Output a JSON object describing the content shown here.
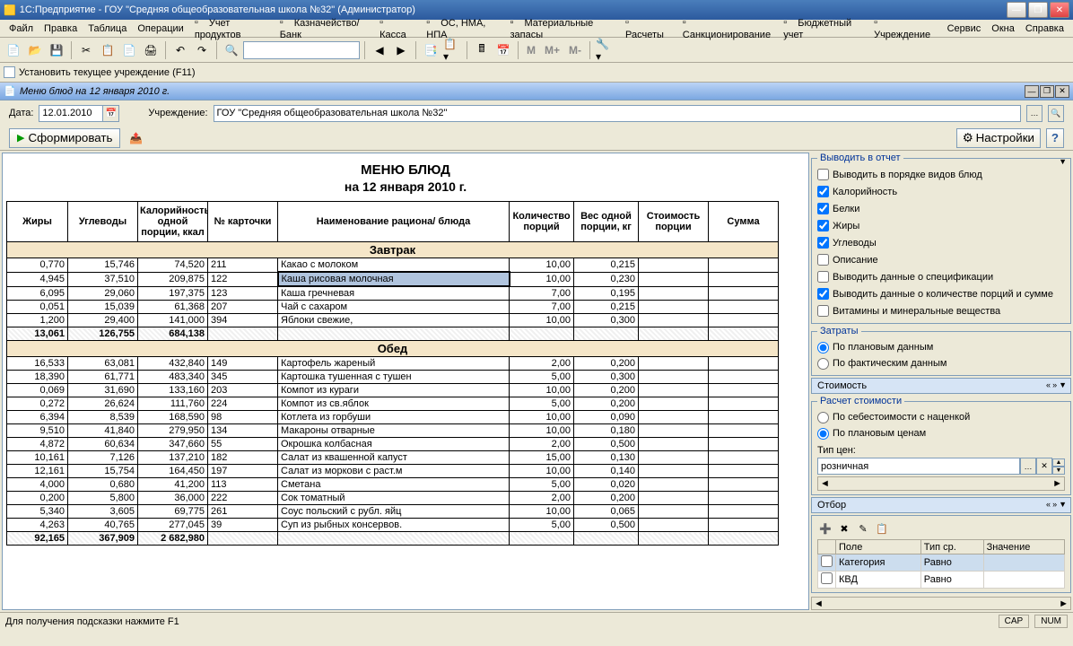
{
  "titlebar": "1С:Предприятие - ГОУ \"Средняя общеобразовательная школа №32\" (Администратор)",
  "menubar": [
    "Файл",
    "Правка",
    "Таблица",
    "Операции",
    "Учет продуктов",
    "Казначейство/Банк",
    "Касса",
    "ОС, НМА, НПА",
    "Материальные запасы",
    "Расчеты",
    "Санкционирование",
    "Бюджетный учет",
    "Учреждение",
    "Сервис",
    "Окна",
    "Справка"
  ],
  "secondbar": {
    "text": "Установить текущее учреждение (F11)"
  },
  "doc_title": "Меню блюд на 12 января 2010 г.",
  "params": {
    "date_label": "Дата:",
    "date": "12.01.2010",
    "inst_label": "Учреждение:",
    "inst": "ГОУ \"Средняя общеобразовательная школа №32\""
  },
  "actions": {
    "form": "Сформировать",
    "settings": "Настройки"
  },
  "report": {
    "title": "МЕНЮ БЛЮД",
    "subtitle": "на 12 января 2010 г.",
    "headers": [
      "Жиры",
      "Углеводы",
      "Калорийность одной порции, ккал",
      "№ карточки",
      "Наименование рациона/ блюда",
      "Количество порций",
      "Вес одной порции, кг",
      "Стоимость порции",
      "Сумма"
    ],
    "meals": [
      {
        "name": "Завтрак",
        "rows": [
          {
            "f": "0,770",
            "c": "15,746",
            "k": "74,520",
            "n": "211",
            "name": "Какао с молоком",
            "q": "10,00",
            "w": "0,215",
            "p": "",
            "s": ""
          },
          {
            "f": "4,945",
            "c": "37,510",
            "k": "209,875",
            "n": "122",
            "name": "Каша рисовая молочная",
            "q": "10,00",
            "w": "0,230",
            "p": "",
            "s": "",
            "sel": true
          },
          {
            "f": "6,095",
            "c": "29,060",
            "k": "197,375",
            "n": "123",
            "name": "Каша гречневая",
            "q": "7,00",
            "w": "0,195",
            "p": "",
            "s": ""
          },
          {
            "f": "0,051",
            "c": "15,039",
            "k": "61,368",
            "n": "207",
            "name": "Чай с сахаром",
            "q": "7,00",
            "w": "0,215",
            "p": "",
            "s": ""
          },
          {
            "f": "1,200",
            "c": "29,400",
            "k": "141,000",
            "n": "394",
            "name": "Яблоки свежие,",
            "q": "10,00",
            "w": "0,300",
            "p": "",
            "s": ""
          }
        ],
        "total": {
          "f": "13,061",
          "c": "126,755",
          "k": "684,138"
        }
      },
      {
        "name": "Обед",
        "rows": [
          {
            "f": "16,533",
            "c": "63,081",
            "k": "432,840",
            "n": "149",
            "name": "Картофель жареный",
            "q": "2,00",
            "w": "0,200",
            "p": "",
            "s": ""
          },
          {
            "f": "18,390",
            "c": "61,771",
            "k": "483,340",
            "n": "345",
            "name": "Картошка тушенная с тушен",
            "q": "5,00",
            "w": "0,300",
            "p": "",
            "s": ""
          },
          {
            "f": "0,069",
            "c": "31,690",
            "k": "133,160",
            "n": "203",
            "name": "Компот из кураги",
            "q": "10,00",
            "w": "0,200",
            "p": "",
            "s": ""
          },
          {
            "f": "0,272",
            "c": "26,624",
            "k": "111,760",
            "n": "224",
            "name": "Компот из св.яблок",
            "q": "5,00",
            "w": "0,200",
            "p": "",
            "s": ""
          },
          {
            "f": "6,394",
            "c": "8,539",
            "k": "168,590",
            "n": "98",
            "name": "Котлета из горбуши",
            "q": "10,00",
            "w": "0,090",
            "p": "",
            "s": ""
          },
          {
            "f": "9,510",
            "c": "41,840",
            "k": "279,950",
            "n": "134",
            "name": "Макароны отварные",
            "q": "10,00",
            "w": "0,180",
            "p": "",
            "s": ""
          },
          {
            "f": "4,872",
            "c": "60,634",
            "k": "347,660",
            "n": "55",
            "name": "Окрошка колбасная",
            "q": "2,00",
            "w": "0,500",
            "p": "",
            "s": ""
          },
          {
            "f": "10,161",
            "c": "7,126",
            "k": "137,210",
            "n": "182",
            "name": "Салат из квашенной капуст",
            "q": "15,00",
            "w": "0,130",
            "p": "",
            "s": ""
          },
          {
            "f": "12,161",
            "c": "15,754",
            "k": "164,450",
            "n": "197",
            "name": "Салат из моркови с раст.м",
            "q": "10,00",
            "w": "0,140",
            "p": "",
            "s": ""
          },
          {
            "f": "4,000",
            "c": "0,680",
            "k": "41,200",
            "n": "113",
            "name": "Сметана",
            "q": "5,00",
            "w": "0,020",
            "p": "",
            "s": ""
          },
          {
            "f": "0,200",
            "c": "5,800",
            "k": "36,000",
            "n": "222",
            "name": "Сок томатный",
            "q": "2,00",
            "w": "0,200",
            "p": "",
            "s": ""
          },
          {
            "f": "5,340",
            "c": "3,605",
            "k": "69,775",
            "n": "261",
            "name": "Соус польский с рубл. яйц",
            "q": "10,00",
            "w": "0,065",
            "p": "",
            "s": ""
          },
          {
            "f": "4,263",
            "c": "40,765",
            "k": "277,045",
            "n": "39",
            "name": "Суп из рыбных консервов.",
            "q": "5,00",
            "w": "0,500",
            "p": "",
            "s": ""
          }
        ],
        "total": {
          "f": "92,165",
          "c": "367,909",
          "k": "2 682,980"
        }
      }
    ]
  },
  "side": {
    "output": {
      "title": "Выводить в отчет",
      "opts": [
        {
          "label": "Выводить в порядке видов блюд",
          "chk": false
        },
        {
          "label": "Калорийность",
          "chk": true
        },
        {
          "label": "Белки",
          "chk": true
        },
        {
          "label": "Жиры",
          "chk": true
        },
        {
          "label": "Углеводы",
          "chk": true
        },
        {
          "label": "Описание",
          "chk": false
        },
        {
          "label": "Выводить данные о спецификации",
          "chk": false
        },
        {
          "label": "Выводить данные о количестве порций и сумме",
          "chk": true
        },
        {
          "label": "Витамины и минеральные вещества",
          "chk": false
        }
      ]
    },
    "zatraty": {
      "title": "Затраты",
      "opts": [
        {
          "label": "По плановым данным",
          "sel": true
        },
        {
          "label": "По фактическим данным",
          "sel": false
        }
      ]
    },
    "stoimost": {
      "title": "Стоимость",
      "raschet": "Расчет стоимости",
      "opts": [
        {
          "label": "По себестоимости с наценкой",
          "sel": false
        },
        {
          "label": "По плановым ценам",
          "sel": true
        }
      ],
      "price_label": "Тип цен:",
      "price": "розничная"
    },
    "otbor": {
      "title": "Отбор",
      "cols": [
        "Поле",
        "Тип ср.",
        "Значение"
      ],
      "rows": [
        {
          "f": "Категория",
          "t": "Равно",
          "v": "",
          "sel": true
        },
        {
          "f": "КВД",
          "t": "Равно",
          "v": ""
        }
      ]
    }
  },
  "statusbar": {
    "hint": "Для получения подсказки нажмите F1",
    "cap": "CAP",
    "num": "NUM"
  }
}
